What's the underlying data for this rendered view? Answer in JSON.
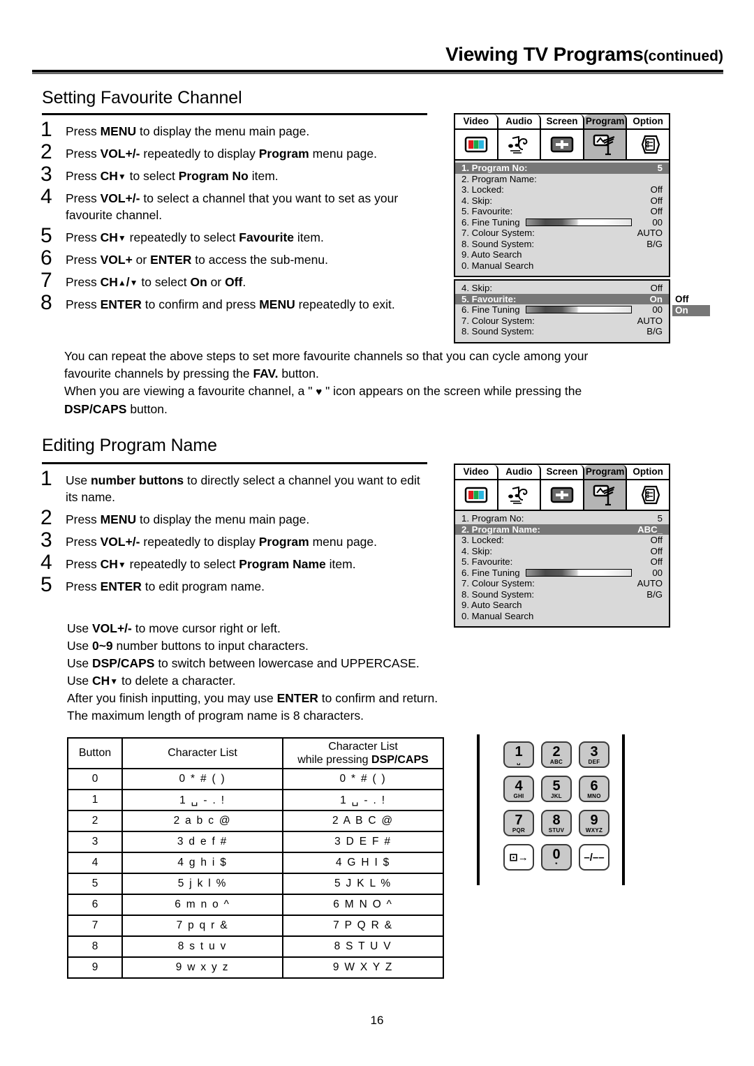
{
  "header": {
    "title": "Viewing TV Programs",
    "continued": "(continued)"
  },
  "section1": {
    "heading": "Setting Favourite Channel",
    "steps": [
      {
        "num": "1",
        "html": "Press <b>MENU</b> to display the menu main page."
      },
      {
        "num": "2",
        "html": "Press <b>VOL+/-</b> repeatedly to display <b>Program</b> menu page."
      },
      {
        "num": "3",
        "html": "Press <b>CH<span class=\"arr\">▼</span></b> to select <b>Program No</b> item."
      },
      {
        "num": "4",
        "html": "Press <b>VOL+/-</b> to select a channel that you want to set as your<br>favourite channel."
      },
      {
        "num": "5",
        "html": "Press <b>CH<span class=\"arr\">▼</span></b> repeatedly to select <b>Favourite</b> item."
      },
      {
        "num": "6",
        "html": "Press <b>VOL+</b> or <b>ENTER</b> to access the sub-menu."
      },
      {
        "num": "7",
        "html": "Press <b>CH<span class=\"arr\">▲</span>/<span class=\"arr\">▼</span></b> to select <b>On</b> or <b>Off</b>."
      },
      {
        "num": "8",
        "html": "Press <b>ENTER</b> to confirm and press <b>MENU</b> repeatedly to exit."
      }
    ],
    "paragraph_lines": [
      "You can repeat the above steps to set more favourite channels so that you can cycle among your",
      "favourite channels by pressing the <b>FAV.</b> button.",
      "When you are viewing a favourite channel, a \" <span class=\"heart\">♥</span> \" icon appears on the screen while pressing the",
      "<b>DSP/CAPS</b> button."
    ]
  },
  "section2": {
    "heading": "Editing Program Name",
    "steps": [
      {
        "num": "1",
        "html": "Use <b>number buttons</b> to directly select a channel you want to edit<br>its name."
      },
      {
        "num": "2",
        "html": "Press <b>MENU</b> to display the menu main page."
      },
      {
        "num": "3",
        "html": "Press <b>VOL+/-</b> repeatedly to display <b>Program</b> menu page."
      },
      {
        "num": "4",
        "html": "Press <b>CH<span class=\"arr\">▼</span></b> repeatedly to select <b>Program Name</b> item."
      },
      {
        "num": "5",
        "html": "Press <b>ENTER</b> to edit program name."
      }
    ],
    "sub_lines": [
      "Use <b>VOL+/-</b> to move cursor right or left.",
      "Use <b>0~9</b> number buttons to input characters.",
      "Use <b>DSP/CAPS</b> to switch between lowercase and UPPERCASE.",
      "Use <b>CH<span class=\"arr\">▼</span></b> to delete a character.",
      "After you finish inputting, you may use <b>ENTER</b> to confirm and return.",
      "The maximum length of program name is 8 characters."
    ]
  },
  "osd_tabs": [
    "Video",
    "Audio",
    "Screen",
    "Program",
    "Option"
  ],
  "osd_active_tab": "Program",
  "osd_menu_1": {
    "rows": [
      {
        "label": "1. Program No:",
        "value": "5",
        "highlight": true
      },
      {
        "label": "2. Program Name:",
        "value": "",
        "highlight": false
      },
      {
        "label": "3. Locked:",
        "value": "Off",
        "highlight": false
      },
      {
        "label": "4. Skip:",
        "value": "Off",
        "highlight": false
      },
      {
        "label": "5. Favourite:",
        "value": "Off",
        "highlight": false
      },
      {
        "label": "6. Fine Tuning",
        "value": "00",
        "highlight": false,
        "bar": true
      },
      {
        "label": "7. Colour System:",
        "value": "AUTO",
        "highlight": false
      },
      {
        "label": "8. Sound System:",
        "value": "B/G",
        "highlight": false
      },
      {
        "label": "9. Auto Search",
        "value": "",
        "highlight": false
      },
      {
        "label": "0. Manual Search",
        "value": "",
        "highlight": false
      }
    ]
  },
  "osd_menu_2": {
    "rows": [
      {
        "label": "4. Skip:",
        "value": "Off",
        "highlight": false
      },
      {
        "label": "5. Favourite:",
        "value": "On",
        "highlight": true
      },
      {
        "label": "6. Fine Tuning",
        "value": "00",
        "highlight": false,
        "bar": true
      },
      {
        "label": "7. Colour System:",
        "value": "AUTO",
        "highlight": false
      },
      {
        "label": "8. Sound System:",
        "value": "B/G",
        "highlight": false
      }
    ],
    "popup": {
      "options": [
        "Off",
        "On"
      ],
      "selected": "On"
    }
  },
  "osd_menu_3": {
    "rows": [
      {
        "label": "1. Program No:",
        "value": "5",
        "highlight": false
      },
      {
        "label": "2. Program Name:",
        "value": "ABC_",
        "highlight": true
      },
      {
        "label": "3. Locked:",
        "value": "Off",
        "highlight": false
      },
      {
        "label": "4. Skip:",
        "value": "Off",
        "highlight": false
      },
      {
        "label": "5. Favourite:",
        "value": "Off",
        "highlight": false
      },
      {
        "label": "6. Fine Tuning",
        "value": "00",
        "highlight": false,
        "bar": true
      },
      {
        "label": "7. Colour System:",
        "value": "AUTO",
        "highlight": false
      },
      {
        "label": "8. Sound System:",
        "value": "B/G",
        "highlight": false
      },
      {
        "label": "9. Auto Search",
        "value": "",
        "highlight": false
      },
      {
        "label": "0. Manual Search",
        "value": "",
        "highlight": false
      }
    ]
  },
  "char_table": {
    "headers": {
      "button": "Button",
      "list": "Character List",
      "caps_line1": "Character List",
      "caps_line2_prefix": "while pressing ",
      "caps_line2_bold": "DSP/CAPS"
    },
    "rows": [
      {
        "button": "0",
        "list": "0 * # ( )",
        "caps": "0 * # ( )"
      },
      {
        "button": "1",
        "list": "1 ␣ - . !",
        "caps": "1 ␣ - . !"
      },
      {
        "button": "2",
        "list": "2 a b c @",
        "caps": "2 A B C @"
      },
      {
        "button": "3",
        "list": "3 d e f #",
        "caps": "3 D E F #"
      },
      {
        "button": "4",
        "list": "4 g h i $",
        "caps": "4 G H I $"
      },
      {
        "button": "5",
        "list": "5 j k l %",
        "caps": "5 J K L %"
      },
      {
        "button": "6",
        "list": "6 m n o ^",
        "caps": "6 M N O ^"
      },
      {
        "button": "7",
        "list": "7 p q r &",
        "caps": "7 P Q R &"
      },
      {
        "button": "8",
        "list": "8 s t u v",
        "caps": "8 S T U V"
      },
      {
        "button": "9",
        "list": "9 w x y z",
        "caps": "9 W X Y Z"
      }
    ]
  },
  "keypad": {
    "keys": [
      {
        "big": "1",
        "sub": "␣",
        "style": "grey"
      },
      {
        "big": "2",
        "sub": "ABC",
        "style": "grey"
      },
      {
        "big": "3",
        "sub": "DEF",
        "style": "grey"
      },
      {
        "big": "4",
        "sub": "GHI",
        "style": "grey"
      },
      {
        "big": "5",
        "sub": "JKL",
        "style": "grey"
      },
      {
        "big": "6",
        "sub": "MNO",
        "style": "grey"
      },
      {
        "big": "7",
        "sub": "PQR",
        "style": "grey"
      },
      {
        "big": "8",
        "sub": "STUV",
        "style": "grey"
      },
      {
        "big": "9",
        "sub": "WXYZ",
        "style": "grey"
      },
      {
        "glyph": "⊡→",
        "style": "white",
        "name": "input-source-key"
      },
      {
        "big": "0",
        "sub": "*",
        "style": "grey"
      },
      {
        "glyph": "–/––",
        "style": "white",
        "name": "dash-key"
      }
    ]
  },
  "page_number": "16"
}
